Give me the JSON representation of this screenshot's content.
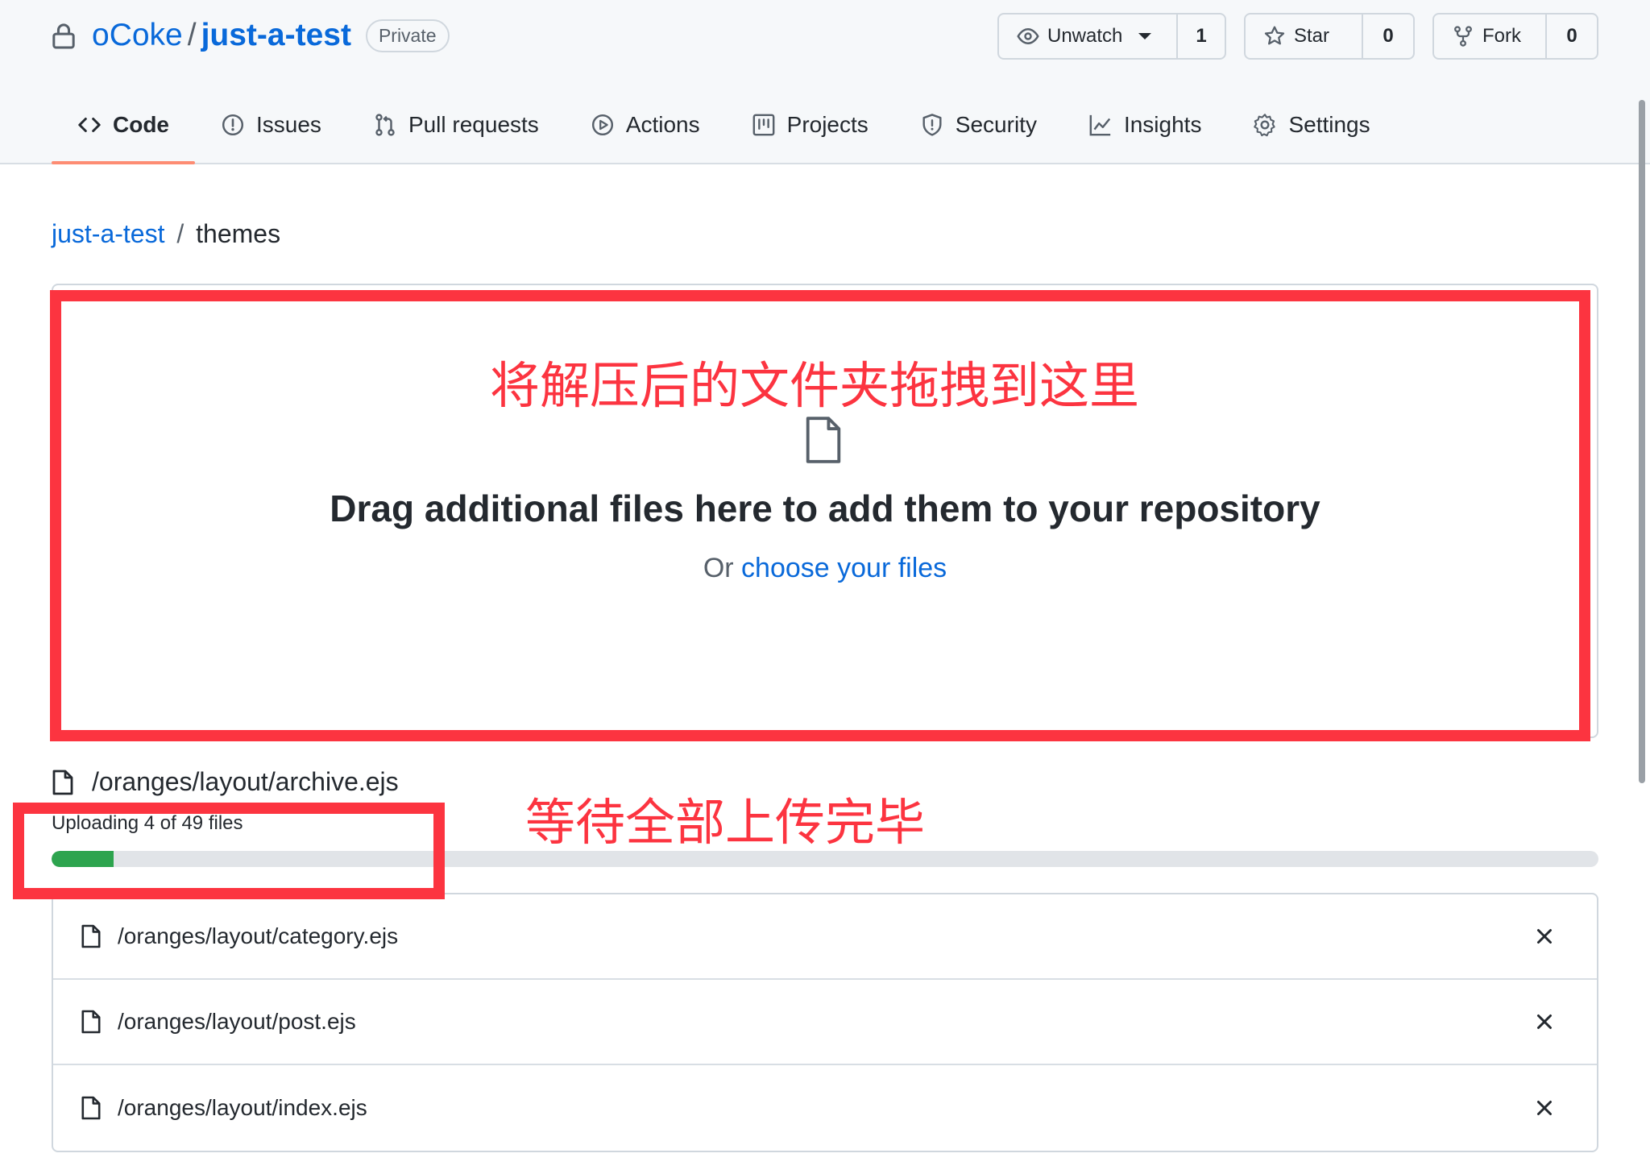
{
  "repo": {
    "owner": "oCoke",
    "separator": "/",
    "name": "just-a-test",
    "visibility": "Private"
  },
  "actions": {
    "watch": {
      "label": "Unwatch",
      "count": "1"
    },
    "star": {
      "label": "Star",
      "count": "0"
    },
    "fork": {
      "label": "Fork",
      "count": "0"
    }
  },
  "tabs": [
    {
      "label": "Code",
      "icon": "code-icon",
      "active": true
    },
    {
      "label": "Issues",
      "icon": "issue-icon"
    },
    {
      "label": "Pull requests",
      "icon": "pull-request-icon"
    },
    {
      "label": "Actions",
      "icon": "play-icon"
    },
    {
      "label": "Projects",
      "icon": "project-icon"
    },
    {
      "label": "Security",
      "icon": "shield-icon"
    },
    {
      "label": "Insights",
      "icon": "graph-icon"
    },
    {
      "label": "Settings",
      "icon": "gear-icon"
    }
  ],
  "breadcrumb": {
    "root": "just-a-test",
    "separator": "/",
    "current": "themes"
  },
  "drop_zone": {
    "heading": "Drag additional files here to add them to your repository",
    "prefix": "Or",
    "link": "choose your files"
  },
  "upload": {
    "current_file": "/oranges/layout/archive.ejs",
    "status": "Uploading 4 of 49 files",
    "progress": 0.04
  },
  "files": [
    {
      "name": "/oranges/layout/category.ejs"
    },
    {
      "name": "/oranges/layout/post.ejs"
    },
    {
      "name": "/oranges/layout/index.ejs"
    }
  ],
  "annotations": {
    "drop_note": "将解压后的文件夹拖拽到这里",
    "upload_note": "等待全部上传完毕",
    "color": "#fc3440"
  },
  "colors": {
    "link": "#0969da",
    "active_tab_underline": "#fd8c73",
    "progress": "#2da44e",
    "annotation": "#fc3440"
  }
}
